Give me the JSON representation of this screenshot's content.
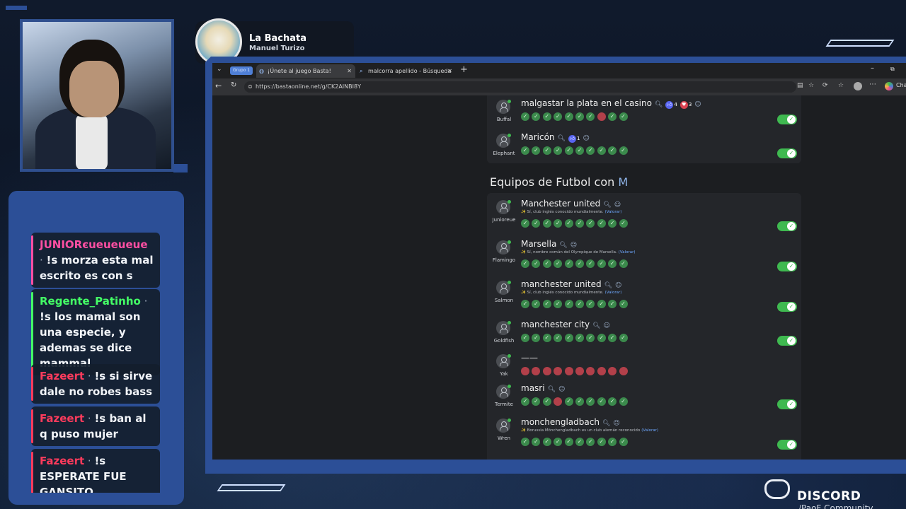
{
  "streamer": {
    "title": "La Bachata",
    "subtitle": "Manuel Turizo"
  },
  "chat": [
    {
      "user": "JUNIORєueueueue",
      "text": "!s morza esta mal escrito es con s",
      "color": "#ff4fa3"
    },
    {
      "user": "Regente_Patinho",
      "text": "!s los mamal son una especie, y ademas se dice mammal",
      "color": "#44ff66"
    },
    {
      "user": "Fazeert",
      "text": "!s si sirve dale no robes bass",
      "color": "#ff3b5c"
    },
    {
      "user": "Fazeert",
      "text": "!s ban al q puso mujer",
      "color": "#ff3b5c"
    },
    {
      "user": "Fazeert",
      "text": "!s ESPERATE FUE GANSITO",
      "color": "#ff3b5c"
    }
  ],
  "browser": {
    "group_label": "Grupo 1",
    "tabs": [
      {
        "label": "¡Únete al juego Basta!",
        "active": true
      },
      {
        "label": "malcorra apellido - Búsqueda",
        "active": false
      }
    ],
    "url": "https://bastaonline.net/g/CK2AINBI8Y",
    "right_label": "Chat"
  },
  "game": {
    "section_letter": "M",
    "section_title_prefix": "Equipos de Futbol con ",
    "prev_rows": [
      {
        "nick": "Buffal",
        "word": "malgastar la plata en el casino",
        "reactions": [
          {
            "icon": "like",
            "count": "4"
          },
          {
            "icon": "heart",
            "count": "3"
          }
        ],
        "dots": "gggggggrgg",
        "valid": true
      },
      {
        "nick": "Elephant",
        "word": "Maricón",
        "reactions": [
          {
            "icon": "like",
            "count": "1"
          }
        ],
        "dots": "gggggggggg",
        "valid": true
      }
    ],
    "rows": [
      {
        "nick": "Junioreue",
        "word": "Manchester united",
        "note": "Sí, club inglés conocido mundialmente.",
        "dots": "gggggggggg",
        "valid": true
      },
      {
        "nick": "Flamingo",
        "word": "Marsella",
        "note": "Sí, nombre común del Olympique de Marsella.",
        "dots": "gggggggggg",
        "valid": true
      },
      {
        "nick": "Salmon",
        "word": "manchester united",
        "note": "Sí, club inglés conocido mundialmente.",
        "dots": "gggggggggg",
        "valid": true
      },
      {
        "nick": "Goldfish",
        "word": "manchester city",
        "note": "",
        "dots": "gggggggggg",
        "valid": true
      },
      {
        "nick": "Yak",
        "word": "——",
        "note": "",
        "dots": "rrrrrrrrrr",
        "valid": false
      },
      {
        "nick": "Termite",
        "word": "masri",
        "note": "",
        "dots": "gggrgggggg",
        "valid": true
      },
      {
        "nick": "Wren",
        "word": "monchengladbach",
        "note": "Borussia Mönchengladbach es un club alemán reconocido",
        "dots": "gggggggggg",
        "valid": true
      }
    ],
    "valorar_label": "(Valorar)"
  },
  "discord": {
    "label": "DISCORD",
    "sub": "/PaoF Community"
  },
  "colors": {
    "frame": "#2c4f97",
    "green": "#3fb950",
    "red": "#b2404a"
  }
}
